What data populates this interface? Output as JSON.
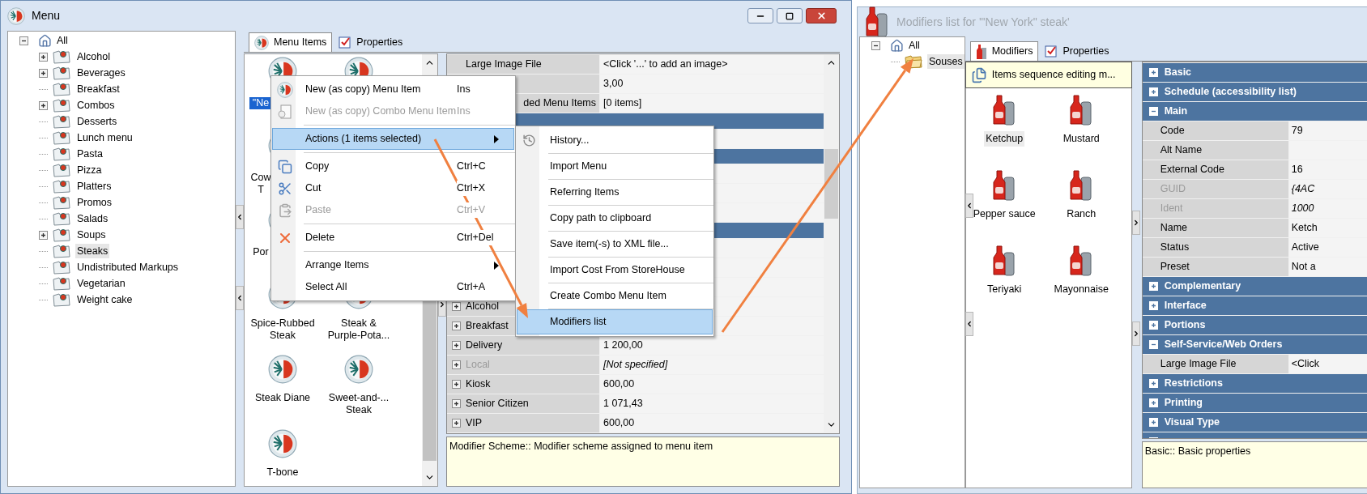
{
  "menu_window": {
    "title": "Menu",
    "active": true,
    "tree": {
      "label": "All",
      "expanded": true,
      "selected": false,
      "children": [
        {
          "label": "Alcohol",
          "kind": "collapsed",
          "selected": false
        },
        {
          "label": "Beverages",
          "kind": "collapsed",
          "selected": false
        },
        {
          "label": "Breakfast",
          "kind": "leaf",
          "selected": false
        },
        {
          "label": "Combos",
          "kind": "collapsed",
          "selected": false
        },
        {
          "label": "Desserts",
          "kind": "leaf",
          "selected": false
        },
        {
          "label": "Lunch menu",
          "kind": "leaf",
          "selected": false
        },
        {
          "label": "Pasta",
          "kind": "leaf",
          "selected": false
        },
        {
          "label": "Pizza",
          "kind": "leaf",
          "selected": false
        },
        {
          "label": "Platters",
          "kind": "leaf",
          "selected": false
        },
        {
          "label": "Promos",
          "kind": "leaf",
          "selected": false
        },
        {
          "label": "Salads",
          "kind": "leaf",
          "selected": false
        },
        {
          "label": "Soups",
          "kind": "collapsed",
          "selected": false
        },
        {
          "label": "Steaks",
          "kind": "leaf",
          "selected": true
        },
        {
          "label": "Undistributed Markups",
          "kind": "leaf",
          "selected": false
        },
        {
          "label": "Vegetarian",
          "kind": "leaf",
          "selected": false
        },
        {
          "label": "Weight cake",
          "kind": "leaf",
          "selected": false
        }
      ]
    },
    "tabs": [
      {
        "label": "Menu Items",
        "selected": true
      },
      {
        "label": "Properties",
        "selected": false
      }
    ],
    "items": [
      {
        "kind": "partial",
        "label": "\"Ne",
        "selected": true
      },
      {
        "kind": "icon_only"
      },
      {
        "kind": "partial",
        "label": "Cow T",
        "selected": false
      },
      {
        "kind": "covered"
      },
      {
        "kind": "partial",
        "label": "Por",
        "selected": false
      },
      {
        "kind": "covered"
      },
      {
        "kind": "item",
        "label": "Spice-Rubbed Steak",
        "selected": false
      },
      {
        "kind": "item",
        "label": "Steak & Purple-Pota...",
        "selected": false
      },
      {
        "kind": "item",
        "label": "Steak Diane",
        "selected": false
      },
      {
        "kind": "item",
        "label": "Sweet-and-... Steak",
        "selected": false
      },
      {
        "kind": "item",
        "label": "T-bone",
        "selected": false
      }
    ],
    "properties": [
      {
        "kind": "property",
        "name": "Large Image File",
        "value": "<Click '...' to add an image>"
      },
      {
        "kind": "property",
        "value": "3,00"
      },
      {
        "kind": "partial",
        "name": "ded Menu Items",
        "value": "[0 items]"
      },
      {
        "kind": "category"
      },
      {
        "kind": "property"
      },
      {
        "kind": "category"
      },
      {
        "kind": "property"
      },
      {
        "kind": "property"
      },
      {
        "kind": "property"
      },
      {
        "kind": "category"
      },
      {
        "kind": "property"
      },
      {
        "kind": "property"
      },
      {
        "kind": "property"
      },
      {
        "kind": "group",
        "name": "Alcohol",
        "expanded": false,
        "disabled": false
      },
      {
        "kind": "group",
        "name": "Breakfast",
        "expanded": false,
        "disabled": false
      },
      {
        "kind": "group",
        "name": "Delivery",
        "value": "1 200,00",
        "expanded": false,
        "disabled": false
      },
      {
        "kind": "group",
        "name": "Local",
        "value": "[Not specified]",
        "expanded": false,
        "disabled": true
      },
      {
        "kind": "group",
        "name": "Kiosk",
        "value": "600,00",
        "expanded": false,
        "disabled": false
      },
      {
        "kind": "group",
        "name": "Senior Citizen",
        "value": "1 071,43",
        "expanded": false,
        "disabled": false
      },
      {
        "kind": "group",
        "name": "VIP",
        "value": "600,00",
        "expanded": false,
        "disabled": false
      }
    ],
    "description": "Modifier Scheme:: Modifier scheme assigned to menu item"
  },
  "context_menu": {
    "items": [
      {
        "kind": "item",
        "label": "New (as copy) Menu Item",
        "shortcut": "Ins",
        "disabled": false,
        "selected": false,
        "submenu": false
      },
      {
        "kind": "item",
        "label": "New (as copy) Combo Menu Item",
        "shortcut": "Ins",
        "disabled": true,
        "selected": false,
        "submenu": false
      },
      {
        "kind": "separator"
      },
      {
        "kind": "item",
        "label": "Actions (1 items selected)",
        "disabled": false,
        "selected": true,
        "submenu": true
      },
      {
        "kind": "separator"
      },
      {
        "kind": "item",
        "label": "Copy",
        "shortcut": "Ctrl+C",
        "disabled": false,
        "selected": false,
        "submenu": false
      },
      {
        "kind": "item",
        "label": "Cut",
        "shortcut": "Ctrl+X",
        "disabled": false,
        "selected": false,
        "submenu": false
      },
      {
        "kind": "item",
        "label": "Paste",
        "shortcut": "Ctrl+V",
        "disabled": true,
        "selected": false,
        "submenu": false
      },
      {
        "kind": "separator"
      },
      {
        "kind": "item",
        "label": "Delete",
        "shortcut": "Ctrl+Del",
        "disabled": false,
        "selected": false,
        "submenu": false
      },
      {
        "kind": "separator"
      },
      {
        "kind": "item",
        "label": "Arrange Items",
        "disabled": false,
        "selected": false,
        "submenu": true
      },
      {
        "kind": "item",
        "label": "Select All",
        "shortcut": "Ctrl+A",
        "disabled": false,
        "selected": false,
        "submenu": false
      }
    ]
  },
  "actions_submenu": {
    "items": [
      {
        "label": "History...",
        "selected": false
      },
      {
        "label": "Import Menu",
        "selected": false
      },
      {
        "label": "Referring Items",
        "selected": false
      },
      {
        "label": "Copy path to clipboard",
        "selected": false
      },
      {
        "label": "Save item(-s) to XML file...",
        "selected": false
      },
      {
        "label": "Import Cost From StoreHouse",
        "selected": false
      },
      {
        "label": "Create Combo Menu Item",
        "selected": false
      },
      {
        "label": "Modifiers list",
        "selected": true
      }
    ]
  },
  "modifiers_window": {
    "title": "Modifiers list for '\"New York\" steak'",
    "active": false,
    "tree": {
      "label": "All",
      "expanded": true,
      "selected": false,
      "children": [
        {
          "label": "Souses",
          "selected": true
        }
      ]
    },
    "tabs": [
      {
        "label": "Modifiers",
        "selected": true
      },
      {
        "label": "Properties",
        "selected": false
      }
    ],
    "banner": "Items sequence editing m...",
    "modifiers": [
      {
        "label": "Ketchup",
        "selected": true
      },
      {
        "label": "Mustard",
        "selected": false
      },
      {
        "label": "Pepper sauce",
        "selected": false
      },
      {
        "label": "Ranch",
        "selected": false
      },
      {
        "label": "Teriyaki",
        "selected": false
      },
      {
        "label": "Mayonnaise",
        "selected": false
      }
    ],
    "sections": [
      {
        "name": "Basic",
        "expanded": false
      },
      {
        "name": "Schedule (accessibility list)",
        "expanded": false
      },
      {
        "name": "Main",
        "expanded": true,
        "rows": [
          {
            "name": "Code",
            "value": "79",
            "disabled": false
          },
          {
            "name": "Alt Name",
            "disabled": false
          },
          {
            "name": "External Code",
            "value": "16",
            "disabled": false
          },
          {
            "name": "GUID",
            "value": "{4AC",
            "disabled": true
          },
          {
            "name": "Ident",
            "value": "1000",
            "disabled": true
          },
          {
            "name": "Name",
            "value": "Ketch",
            "disabled": false
          },
          {
            "name": "Status",
            "value": "Active",
            "disabled": false
          },
          {
            "name": "Preset",
            "value": "Not a",
            "disabled": false
          }
        ]
      },
      {
        "name": "Complementary",
        "expanded": false
      },
      {
        "name": "Interface",
        "expanded": false
      },
      {
        "name": "Portions",
        "expanded": false
      },
      {
        "name": "Self-Service/Web Orders",
        "expanded": true,
        "rows": [
          {
            "name": "Large Image File",
            "value": "<Click",
            "disabled": false
          }
        ]
      },
      {
        "name": "Restrictions",
        "expanded": false
      },
      {
        "name": "Printing",
        "expanded": false
      },
      {
        "name": "Visual Type",
        "expanded": false
      },
      {
        "expanded": false
      }
    ],
    "description": "Basic:: Basic properties"
  }
}
